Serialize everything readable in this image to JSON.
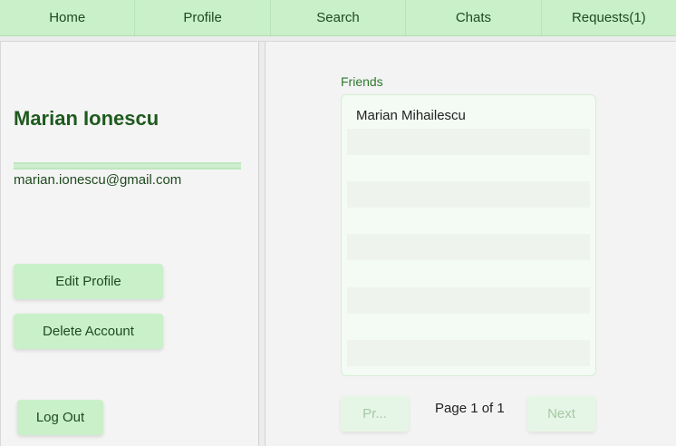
{
  "nav": {
    "items": [
      {
        "label": "Home"
      },
      {
        "label": "Profile"
      },
      {
        "label": "Search"
      },
      {
        "label": "Chats"
      },
      {
        "label": "Requests(1)"
      }
    ]
  },
  "profile": {
    "name": "Marian Ionescu",
    "email": "marian.ionescu@gmail.com",
    "edit_label": "Edit Profile",
    "delete_label": "Delete Account",
    "logout_label": "Log Out"
  },
  "friends": {
    "heading": "Friends",
    "list": [
      "Marian Mihailescu",
      "",
      "",
      "",
      "",
      ""
    ]
  },
  "pagination": {
    "prev_label": "Pr...",
    "page_text": "Page 1 of 1",
    "next_label": "Next",
    "prev_disabled": true,
    "next_disabled": true
  },
  "colors": {
    "nav_bg": "#c9f0c9",
    "accent_green": "#1e5a1e",
    "button_bg": "#c9f0c9"
  }
}
